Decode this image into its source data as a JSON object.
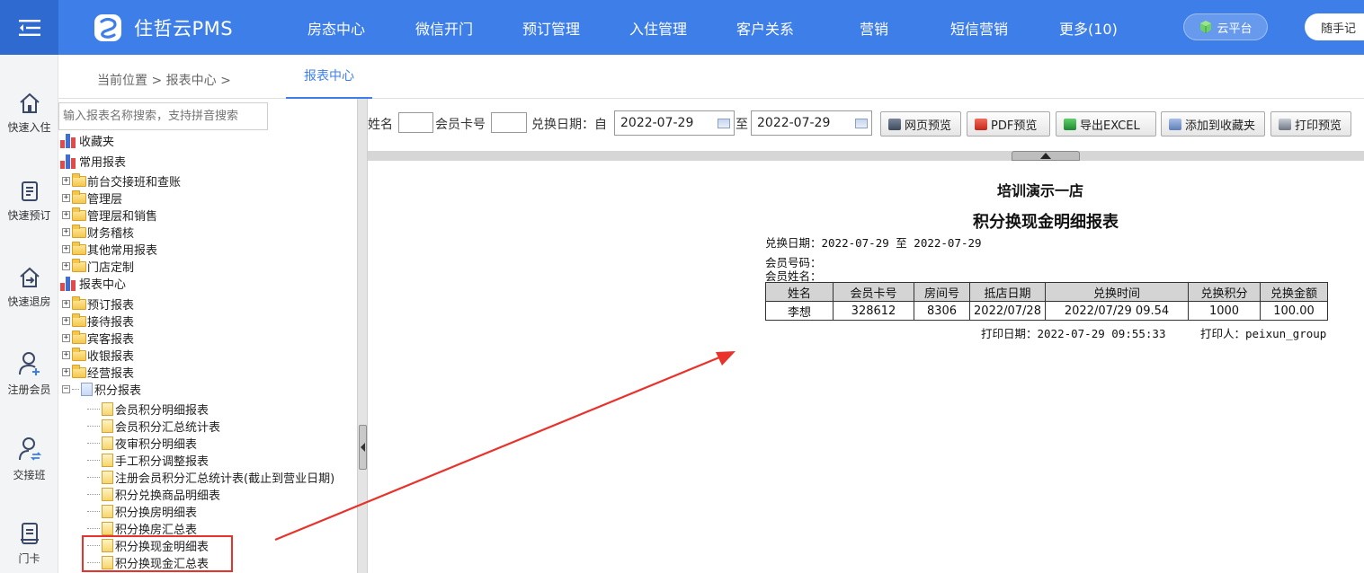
{
  "app": {
    "brand": "住哲云PMS",
    "nav": [
      "房态中心",
      "微信开门",
      "预订管理",
      "入住管理",
      "客户关系",
      "营销",
      "短信营销",
      "更多(10)"
    ],
    "cloud_label": "云平台",
    "note_label": "随手记"
  },
  "quickbar": {
    "items": [
      "快速入住",
      "快速预订",
      "快速退房",
      "注册会员",
      "交接班",
      "门卡"
    ]
  },
  "breadcrumb": {
    "text": "当前位置 > 报表中心 >",
    "active_tab": "报表中心"
  },
  "tree": {
    "search_placeholder": "输入报表名称搜索，支持拼音搜索",
    "root_favorites": "收藏夹",
    "root_common": "常用报表",
    "common_children": [
      "前台交接班和查账",
      "管理层",
      "管理层和销售",
      "财务稽核",
      "其他常用报表",
      "门店定制"
    ],
    "root_center": "报表中心",
    "center_children": [
      "预订报表",
      "接待报表",
      "宾客报表",
      "收银报表",
      "经营报表"
    ],
    "points_folder": "积分报表",
    "points_children": [
      "会员积分明细报表",
      "会员积分汇总统计表",
      "夜审积分明细表",
      "手工积分调整报表",
      "注册会员积分汇总统计表(截止到营业日期)",
      "积分兑换商品明细表",
      "积分换房明细表",
      "积分换房汇总表",
      "积分换现金明细表",
      "积分换现金汇总表"
    ]
  },
  "filters": {
    "name_label": "姓名",
    "card_label": "会员卡号",
    "date_label": "兑换日期：自",
    "date_from": "2022-07-29",
    "to_label": "至",
    "date_to": "2022-07-29",
    "buttons": [
      "网页预览",
      "PDF预览",
      "导出EXCEL",
      "添加到收藏夹",
      "打印预览"
    ]
  },
  "report": {
    "hotel": "培训演示一店",
    "title": "积分换现金明细报表",
    "date_range": "兑换日期：2022-07-29 至 2022-07-29",
    "member_no_label": "会员号码：",
    "member_name_label": "会员姓名：",
    "columns": [
      "姓名",
      "会员卡号",
      "房间号",
      "抵店日期",
      "兑换时间",
      "兑换积分",
      "兑换金额"
    ],
    "rows": [
      [
        "李想",
        "328612",
        "8306",
        "2022/07/28",
        "2022/07/29 09.54",
        "1000",
        "100.00"
      ]
    ],
    "print_date": "打印日期：2022-07-29 09:55:33",
    "printer": "打印人：peixun_group"
  },
  "colors": {
    "topbar": "#3d7ee8",
    "annotation": "#e8322b"
  }
}
